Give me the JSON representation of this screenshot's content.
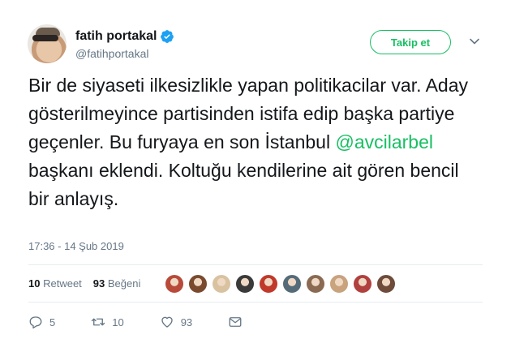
{
  "user": {
    "name": "fatih portakal",
    "handle": "@fatihportakal",
    "avatar_icon": "user-avatar",
    "verified_icon": "verified-badge-icon",
    "verified_color": "#1da1f2"
  },
  "follow_button": {
    "label": "Takip et",
    "color": "#17bf63"
  },
  "tweet": {
    "text_before": "Bir de siyaseti ilkesizlikle yapan politikacilar var. Aday gösterilmeyince partisinden istifa edip başka partiye geçenler. Bu furyaya en son İstanbul ",
    "mention": "@avcilarbel",
    "text_after": " başkanı eklendi. Koltuğu kendilerine ait gören bencil bir anlayış.",
    "timestamp": "17:36 - 14 Şub 2019"
  },
  "stats": {
    "retweets_count": "10",
    "retweets_label": "Retweet",
    "likes_count": "93",
    "likes_label": "Beğeni"
  },
  "likers": [
    {
      "color": "#b84a3a"
    },
    {
      "color": "#7a4a2e"
    },
    {
      "color": "#d9c2a0"
    },
    {
      "color": "#3a3a3a"
    },
    {
      "color": "#c0392b"
    },
    {
      "color": "#556b7a"
    },
    {
      "color": "#8a6a52"
    },
    {
      "color": "#c9a27e"
    },
    {
      "color": "#b0413e"
    },
    {
      "color": "#6e4b3a"
    }
  ],
  "actions": {
    "reply_count": "5",
    "retweet_count": "10",
    "like_count": "93",
    "reply_icon": "reply-icon",
    "retweet_icon": "retweet-icon",
    "like_icon": "heart-icon",
    "dm_icon": "envelope-icon"
  }
}
